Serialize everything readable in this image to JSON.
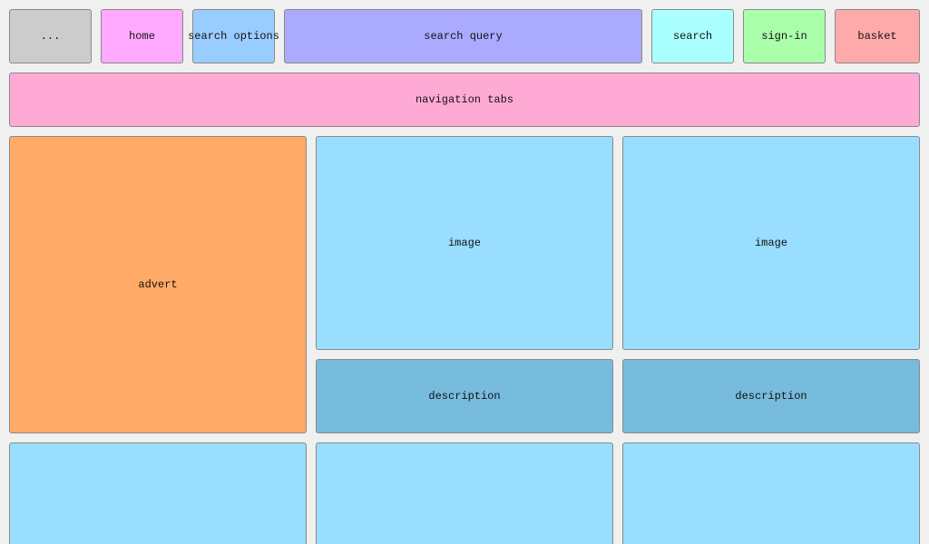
{
  "colors": {
    "background": "#f0f0f0",
    "more": "#cccccc",
    "home": "#ffaaff",
    "search_options": "#99ccff",
    "search_query": "#aaaaff",
    "search": "#aaffff",
    "sign_in": "#aaffaa",
    "basket": "#ffaaaa",
    "navigation_tabs": "#ffaad4",
    "advert": "#ffaa66",
    "image": "#99ddff",
    "description": "#77bbdd"
  },
  "header": {
    "more_label": "...",
    "home_label": "home",
    "search_options_label": "search options",
    "search_query_label": "search query",
    "search_label": "search",
    "sign_in_label": "sign-in",
    "basket_label": "basket"
  },
  "nav": {
    "tabs_label": "navigation tabs"
  },
  "main": {
    "advert_label": "advert",
    "products": [
      {
        "image_label": "image",
        "description_label": "description"
      },
      {
        "image_label": "image",
        "description_label": "description"
      }
    ]
  }
}
